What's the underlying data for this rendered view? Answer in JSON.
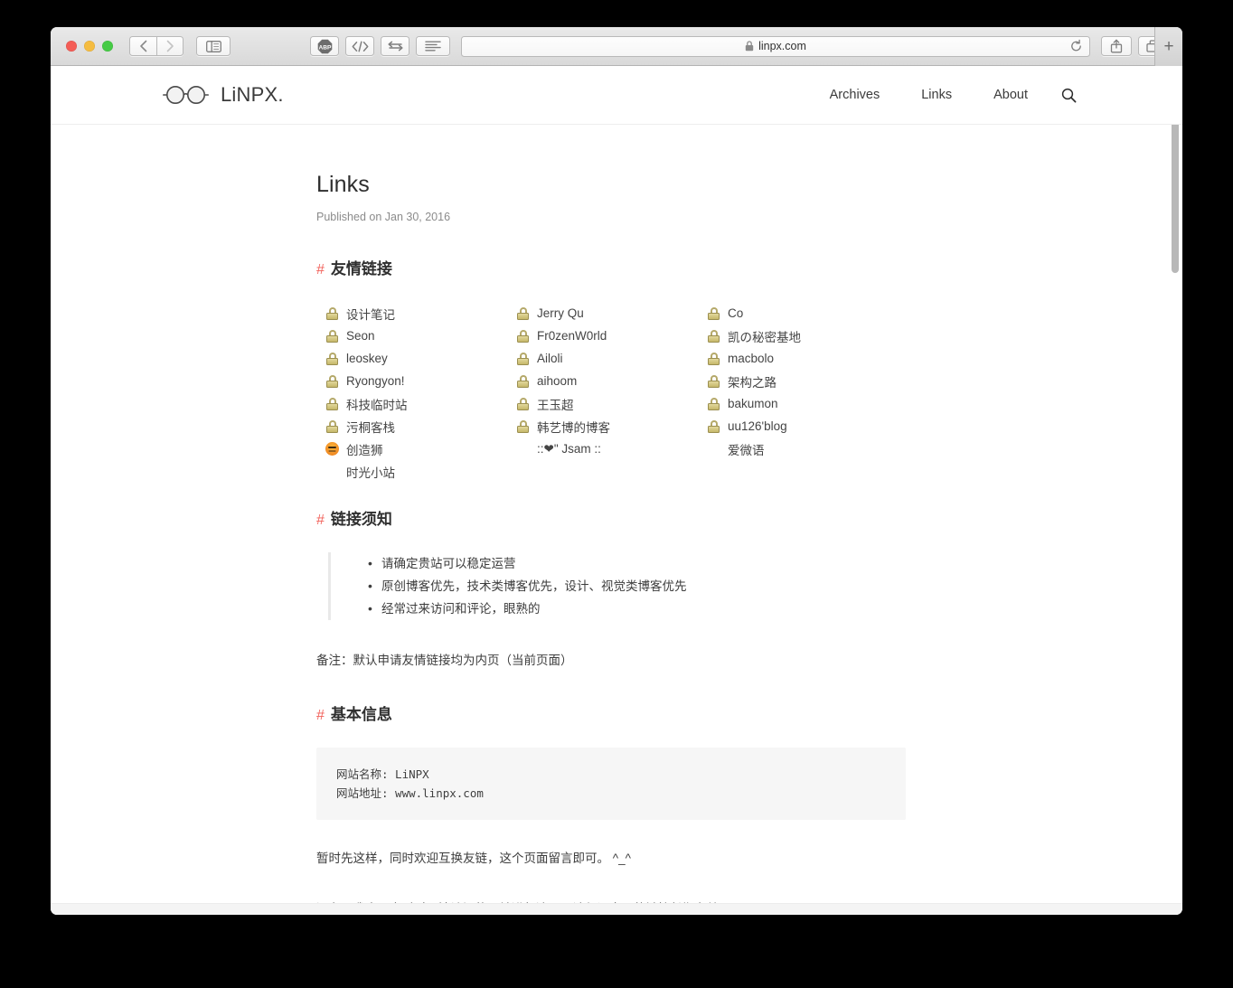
{
  "browser": {
    "traffic_lights": [
      "close",
      "minimize",
      "maximize"
    ],
    "back_label": "‹",
    "forward_label": "›",
    "sidebar_icon": "sidebar-icon",
    "abp_label": "ABP",
    "code_icon": "code-brackets-icon",
    "swap_icon": "swap-arrows-icon",
    "reader_icon": "reader-lines-icon",
    "url": "linpx.com",
    "lock_icon": "lock-icon",
    "reload_icon": "reload-icon",
    "share_icon": "share-icon",
    "tabs_icon": "show-tabs-icon",
    "new_tab_label": "+"
  },
  "site": {
    "brand": "LiNPX.",
    "logo_icon": "glasses-logo-icon",
    "nav": [
      {
        "label": "Archives"
      },
      {
        "label": "Links"
      },
      {
        "label": "About"
      }
    ],
    "search_icon": "search-icon"
  },
  "post": {
    "title": "Links",
    "date": "Published on Jan 30, 2016"
  },
  "sections": {
    "friend_links_heading": "友情链接",
    "rules_heading": "链接须知",
    "basic_info_heading": "基本信息",
    "hash": "#"
  },
  "friend_links": [
    {
      "icon": "lock",
      "label": "设计笔记"
    },
    {
      "icon": "lock",
      "label": "Jerry Qu"
    },
    {
      "icon": "lock",
      "label": "Co"
    },
    {
      "icon": "lock",
      "label": "Seon"
    },
    {
      "icon": "lock",
      "label": "Fr0zenW0rld"
    },
    {
      "icon": "lock",
      "label": "凯の秘密基地"
    },
    {
      "icon": "lock",
      "label": "leoskey"
    },
    {
      "icon": "lock",
      "label": "Ailoli"
    },
    {
      "icon": "lock",
      "label": "macbolo"
    },
    {
      "icon": "lock",
      "label": "Ryongyon!"
    },
    {
      "icon": "lock",
      "label": "aihoom"
    },
    {
      "icon": "lock",
      "label": "架构之路"
    },
    {
      "icon": "lock",
      "label": "科技临时站"
    },
    {
      "icon": "lock",
      "label": "王玉超"
    },
    {
      "icon": "lock",
      "label": "bakumon"
    },
    {
      "icon": "lock",
      "label": "污桐客栈"
    },
    {
      "icon": "lock",
      "label": "韩艺博的博客"
    },
    {
      "icon": "lock",
      "label": "uu126'blog"
    },
    {
      "icon": "lion",
      "label": "创造狮"
    },
    {
      "icon": "none",
      "label": "::❤\" Jsam ::"
    },
    {
      "icon": "none",
      "label": "爱微语"
    },
    {
      "icon": "none",
      "label": "时光小站"
    }
  ],
  "rules": [
    "请确定贵站可以稳定运营",
    "原创博客优先，技术类博客优先，设计、视觉类博客优先",
    "经常过来访问和评论，眼熟的"
  ],
  "note": "备注：默认申请友情链接均为内页（当前页面）",
  "info_block": "网站名称: LiNPX\n网站地址: www.linpx.com",
  "closing_paragraphs": [
    "暂时先这样，同时欢迎互换友链，这个页面留言即可。 ^_^",
    "还有，我会不定时对无法访问的网址进行清理，请保证自己的链接长期有效。"
  ],
  "colors": {
    "accent_hash": "#f2635c",
    "text": "#3d3d3d",
    "muted": "#8b8b8b",
    "code_bg": "#f6f6f6"
  }
}
